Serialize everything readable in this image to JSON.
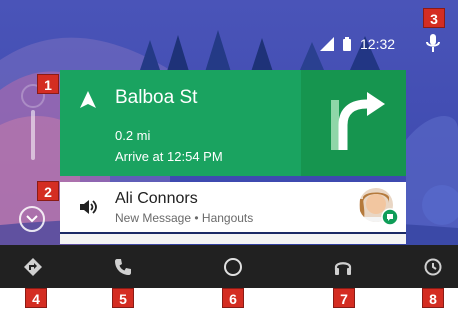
{
  "status": {
    "time": "12:32"
  },
  "navigation": {
    "street": "Balboa St",
    "distance": "0.2 mi",
    "arrival": "Arrive at 12:54 PM"
  },
  "message": {
    "sender": "Ali Connors",
    "subtitle": "New Message • Hangouts"
  },
  "bottom_nav": {
    "items": [
      "navigation-icon",
      "phone-icon",
      "home-icon",
      "headphones-icon",
      "recents-icon"
    ]
  },
  "badges": [
    "1",
    "2",
    "3",
    "4",
    "5",
    "6",
    "7",
    "8"
  ],
  "colors": {
    "wallpaper_sky": "#3c4bb0",
    "nav_card": "#1aa360",
    "turn_panel": "#16954f",
    "bottom_bar": "#212121",
    "badge": "#d42d22",
    "hangouts": "#0f9d58"
  }
}
